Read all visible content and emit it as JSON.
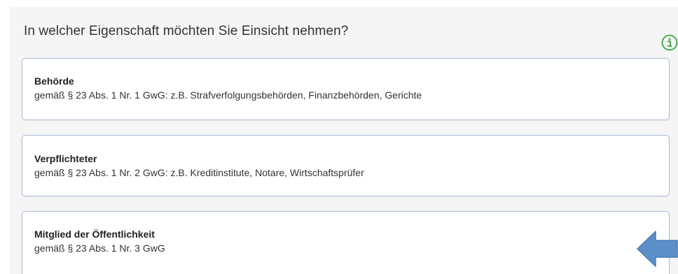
{
  "question": "In welcher Eigenschaft möchten Sie Einsicht nehmen?",
  "info_icon": "info-circle-icon",
  "options": [
    {
      "title": "Behörde",
      "description": "gemäß § 23 Abs. 1 Nr. 1 GwG: z.B. Strafverfolgungsbehörden, Finanzbehörden, Gerichte"
    },
    {
      "title": "Verpflichteter",
      "description": "gemäß § 23 Abs. 1 Nr. 2 GwG: z.B. Kreditinstitute, Notare, Wirtschaftsprüfer"
    },
    {
      "title": "Mitglied der Öffentlichkeit",
      "description": "gemäß § 23 Abs. 1 Nr. 3 GwG"
    }
  ],
  "colors": {
    "panel_background": "#f5f5f5",
    "card_border": "#a8bcd4",
    "info_icon": "#3aa63a",
    "arrow": "#5b8fc9"
  },
  "annotation_arrow": "left-arrow-icon"
}
